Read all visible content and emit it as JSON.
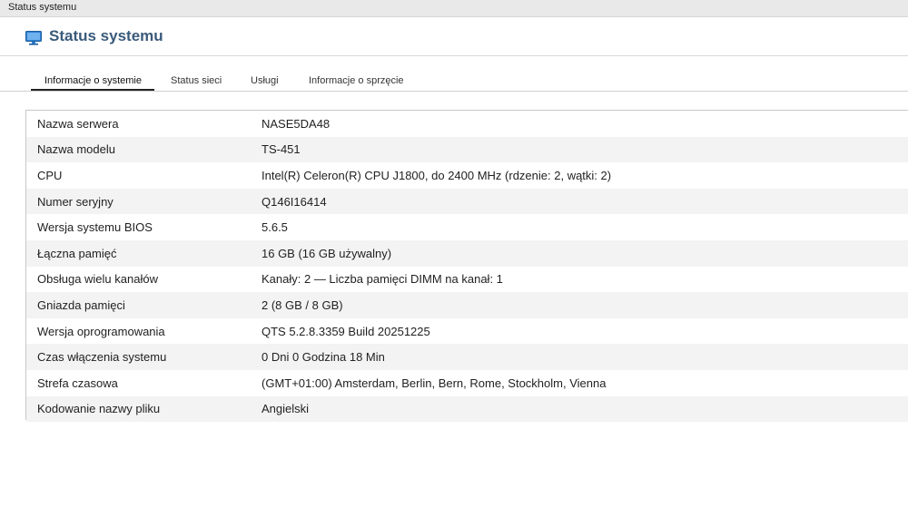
{
  "window": {
    "title": "Status systemu"
  },
  "header": {
    "title": "Status systemu",
    "icon": "monitor-icon"
  },
  "tabs": [
    {
      "label": "Informacje o systemie",
      "active": true
    },
    {
      "label": "Status sieci",
      "active": false
    },
    {
      "label": "Usługi",
      "active": false
    },
    {
      "label": "Informacje o sprzęcie",
      "active": false
    }
  ],
  "system_info": [
    {
      "label": "Nazwa serwera",
      "value": "NASE5DA48"
    },
    {
      "label": "Nazwa modelu",
      "value": "TS-451"
    },
    {
      "label": "CPU",
      "value": "Intel(R) Celeron(R) CPU J1800, do 2400 MHz (rdzenie: 2, wątki: 2)"
    },
    {
      "label": "Numer seryjny",
      "value": "Q146I16414"
    },
    {
      "label": "Wersja systemu BIOS",
      "value": "5.6.5"
    },
    {
      "label": "Łączna pamięć",
      "value": "16 GB (16 GB używalny)"
    },
    {
      "label": "Obsługa wielu kanałów",
      "value": "Kanały: 2 — Liczba pamięci DIMM na kanał: 1"
    },
    {
      "label": "Gniazda pamięci",
      "value": "2 (8 GB / 8 GB)"
    },
    {
      "label": "Wersja oprogramowania",
      "value": "QTS 5.2.8.3359 Build 20251225"
    },
    {
      "label": "Czas włączenia systemu",
      "value": "0 Dni 0 Godzina 18 Min"
    },
    {
      "label": "Strefa czasowa",
      "value": "(GMT+01:00) Amsterdam, Berlin, Bern, Rome, Stockholm, Vienna"
    },
    {
      "label": "Kodowanie nazwy pliku",
      "value": "Angielski"
    }
  ],
  "colors": {
    "accent": "#3a5a7a",
    "icon_blue": "#2f7fd0"
  }
}
